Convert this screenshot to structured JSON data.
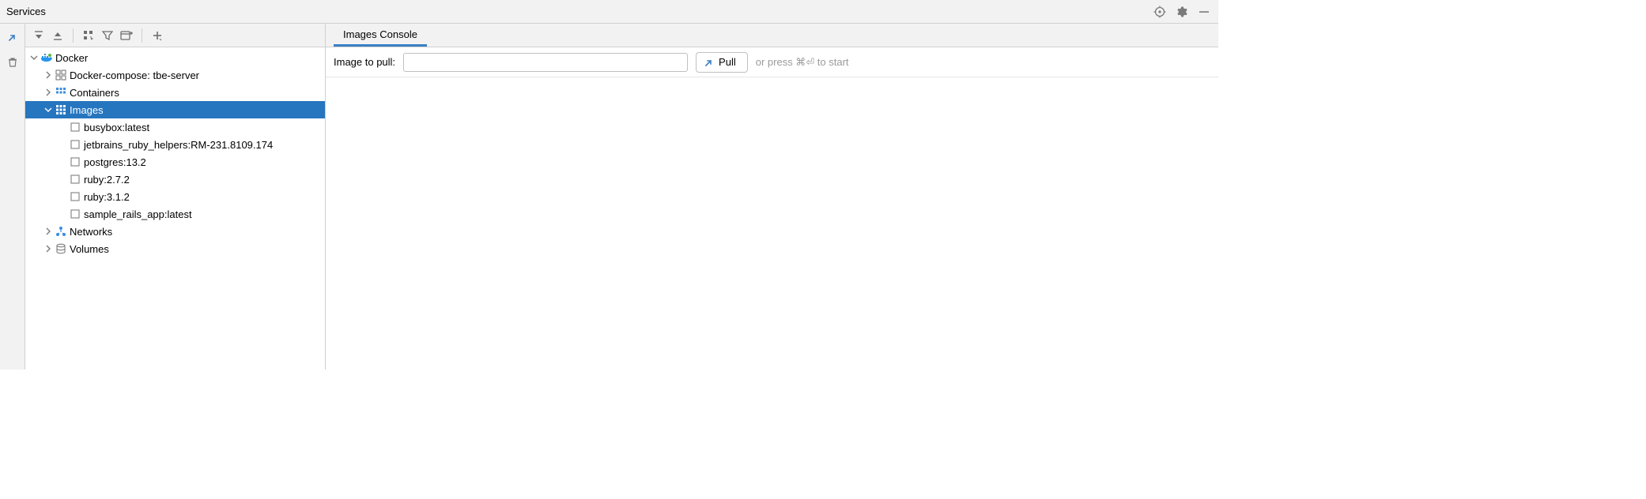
{
  "window": {
    "title": "Services"
  },
  "tree": {
    "root": {
      "label": "Docker",
      "children": {
        "compose": {
          "label": "Docker-compose: tbe-server"
        },
        "containers": {
          "label": "Containers"
        },
        "images": {
          "label": "Images",
          "items": [
            {
              "label": "busybox:latest"
            },
            {
              "label": "jetbrains_ruby_helpers:RM-231.8109.174"
            },
            {
              "label": "postgres:13.2"
            },
            {
              "label": "ruby:2.7.2"
            },
            {
              "label": "ruby:3.1.2"
            },
            {
              "label": "sample_rails_app:latest"
            }
          ]
        },
        "networks": {
          "label": "Networks"
        },
        "volumes": {
          "label": "Volumes"
        }
      }
    }
  },
  "tabs": {
    "active": "Images Console"
  },
  "pull": {
    "label": "Image to pull:",
    "value": "",
    "button": "Pull",
    "hint": "or press ⌘⏎ to start"
  }
}
